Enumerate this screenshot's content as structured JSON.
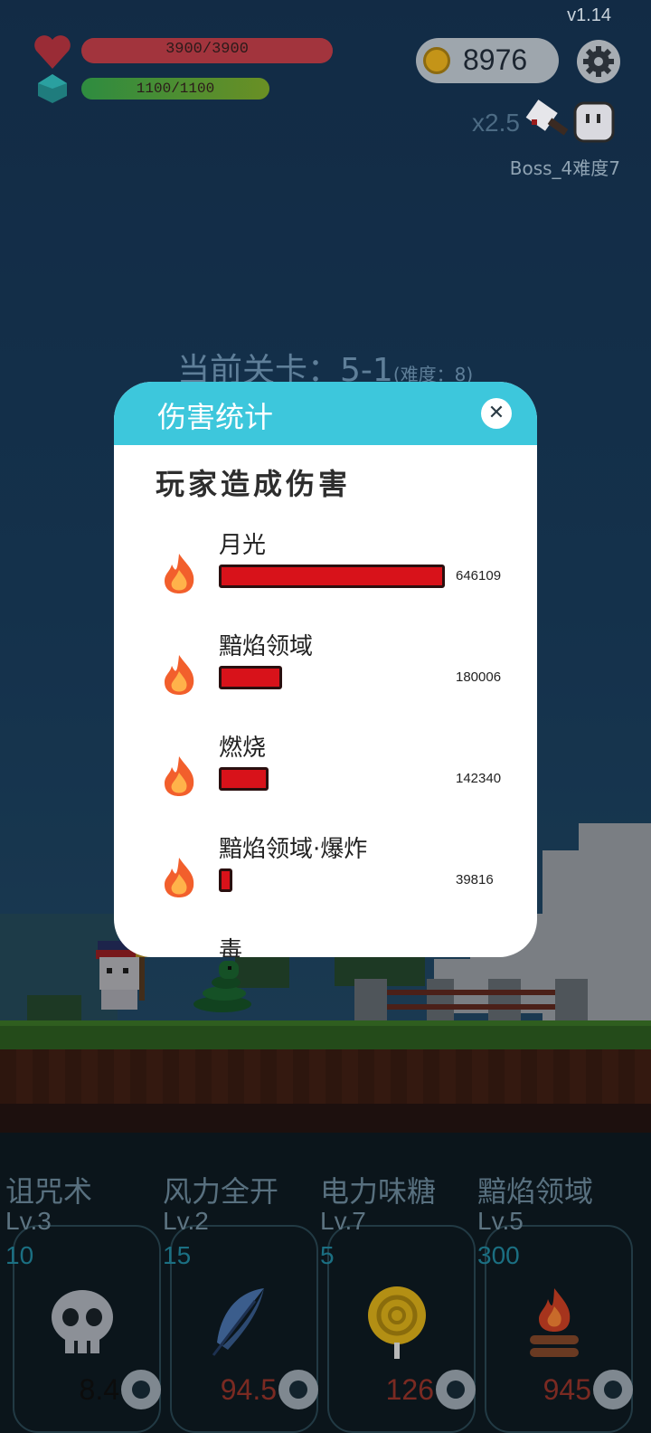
{
  "hud": {
    "version": "v1.14",
    "hp_text": "3900/3900",
    "hp_fraction": 1.0,
    "mp_text": "1100/1100",
    "mp_fraction": 1.0,
    "coins": "8976",
    "speed": "x2.5",
    "boss_label": "Boss_4难度7",
    "icons": {
      "hp": "heart-icon",
      "mp": "gem-icon",
      "coin": "coin-icon",
      "settings": "gear-icon"
    }
  },
  "stage": {
    "label": "当前关卡：5-1",
    "difficulty": "(难度：8)"
  },
  "dialog": {
    "title": "伤害统计",
    "close_symbol": "✕",
    "section": "玩家造成伤害",
    "max_value": 646109,
    "rows": [
      {
        "name": "月光",
        "value": "646109",
        "amount": 646109
      },
      {
        "name": "黯焰领域",
        "value": "180006",
        "amount": 180006
      },
      {
        "name": "燃烧",
        "value": "142340",
        "amount": 142340
      },
      {
        "name": "黯焰领域·爆炸",
        "value": "39816",
        "amount": 39816
      },
      {
        "name": "毒",
        "value": "",
        "amount": 0
      }
    ]
  },
  "skills": [
    {
      "name": "诅咒术",
      "level": "Lv.3",
      "cost": "10",
      "value": "8.4",
      "value_color": "#0c0c0c",
      "icon": "skull-icon"
    },
    {
      "name": "风力全开",
      "level": "Lv.2",
      "cost": "15",
      "value": "94.5",
      "value_color": "#7a2a22",
      "icon": "feather-icon"
    },
    {
      "name": "电力味糖",
      "level": "Lv.7",
      "cost": "5",
      "value": "126",
      "value_color": "#7a2a22",
      "icon": "lollipop-icon"
    },
    {
      "name": "黯焰领域",
      "level": "Lv.5",
      "cost": "300",
      "value": "945",
      "value_color": "#7a2a22",
      "icon": "campfire-icon"
    }
  ]
}
